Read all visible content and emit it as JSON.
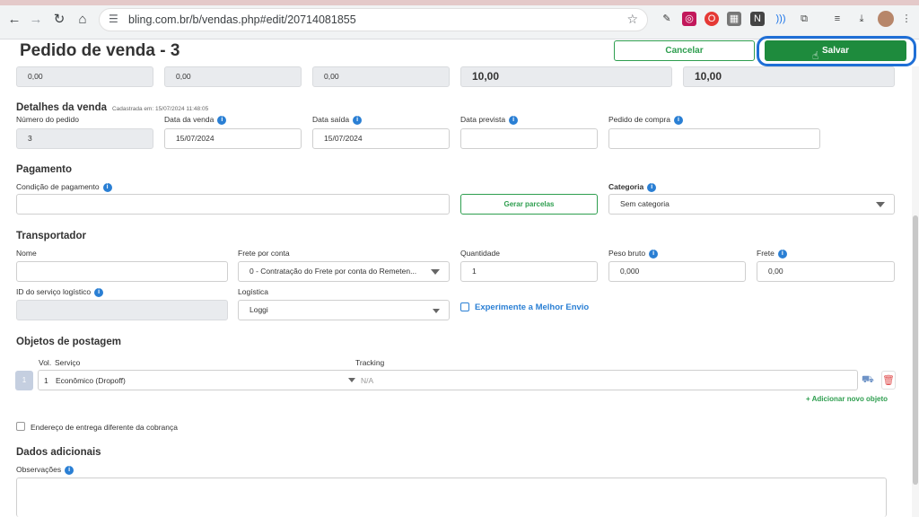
{
  "browser": {
    "url": "bling.com.br/b/vendas.php#edit/20714081855"
  },
  "header": {
    "title": "Pedido de venda - 3",
    "cancel_label": "Cancelar",
    "save_label": "Salvar"
  },
  "totals": [
    "0,00",
    "0,00",
    "0,00",
    "10,00",
    "10,00"
  ],
  "detalhes": {
    "title": "Detalhes da venda",
    "registered": "Cadastrada em: 15/07/2024 11:48:05",
    "numero_label": "Número do pedido",
    "numero_value": "3",
    "data_venda_label": "Data da venda",
    "data_venda_value": "15/07/2024",
    "data_saida_label": "Data saída",
    "data_saida_value": "15/07/2024",
    "data_prevista_label": "Data prevista",
    "pedido_compra_label": "Pedido de compra"
  },
  "pagamento": {
    "title": "Pagamento",
    "condicao_label": "Condição de pagamento",
    "gerar_label": "Gerar parcelas",
    "categoria_label": "Categoria",
    "categoria_value": "Sem categoria"
  },
  "transportador": {
    "title": "Transportador",
    "nome_label": "Nome",
    "frete_conta_label": "Frete por conta",
    "frete_conta_value": "0 - Contratação do Frete por conta do Remeten...",
    "quantidade_label": "Quantidade",
    "quantidade_value": "1",
    "peso_label": "Peso bruto",
    "peso_value": "0,000",
    "frete_label": "Frete",
    "frete_value": "0,00",
    "id_servico_label": "ID do serviço logístico",
    "logistica_label": "Logística",
    "logistica_value": "Loggi",
    "melhor_envio_label": "Experimente a Melhor Envio"
  },
  "objetos": {
    "title": "Objetos de postagem",
    "vol_header": "Vol.",
    "servico_header": "Serviço",
    "tracking_header": "Tracking",
    "row_vol": "1",
    "row_index": "1",
    "row_servico": "Econômico (Dropoff)",
    "row_tracking": "N/A",
    "add_label": "+ Adicionar novo objeto"
  },
  "entrega": {
    "checkbox_label": "Endereço de entrega diferente da cobrança"
  },
  "adicionais": {
    "title": "Dados adicionais",
    "observacoes_label": "Observações"
  }
}
